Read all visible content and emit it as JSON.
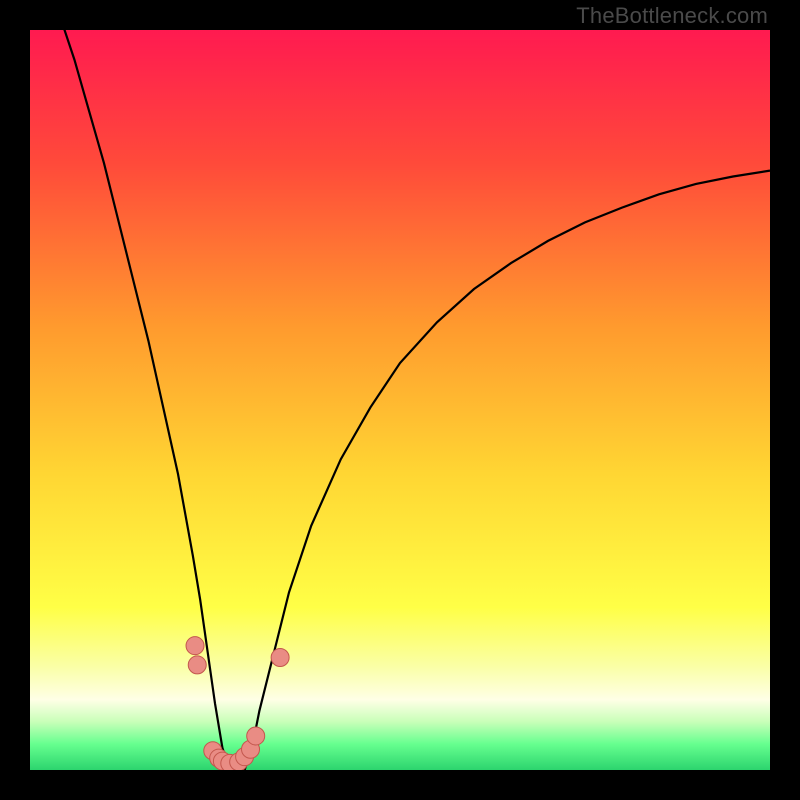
{
  "watermark": "TheBottleneck.com",
  "colors": {
    "black": "#000000",
    "curve_stroke": "#000000",
    "marker_fill": "#e98c84",
    "marker_stroke": "#c3574d"
  },
  "gradient_stops": [
    {
      "offset": 0.0,
      "color": "#ff1a50"
    },
    {
      "offset": 0.18,
      "color": "#ff4a3a"
    },
    {
      "offset": 0.4,
      "color": "#ff9a2e"
    },
    {
      "offset": 0.6,
      "color": "#ffd633"
    },
    {
      "offset": 0.78,
      "color": "#ffff46"
    },
    {
      "offset": 0.86,
      "color": "#faffa6"
    },
    {
      "offset": 0.905,
      "color": "#ffffe6"
    },
    {
      "offset": 0.935,
      "color": "#c8ffb8"
    },
    {
      "offset": 0.965,
      "color": "#66ff8f"
    },
    {
      "offset": 1.0,
      "color": "#2cd46e"
    }
  ],
  "chart_data": {
    "type": "line",
    "title": "",
    "xlabel": "",
    "ylabel": "",
    "xlim": [
      0,
      100
    ],
    "ylim": [
      0,
      100
    ],
    "series": [
      {
        "name": "curve",
        "x": [
          4,
          6,
          8,
          10,
          12,
          14,
          16,
          18,
          20,
          22,
          23,
          24,
          25,
          26,
          27,
          28,
          29,
          30,
          31,
          33,
          35,
          38,
          42,
          46,
          50,
          55,
          60,
          65,
          70,
          75,
          80,
          85,
          90,
          95,
          100
        ],
        "y": [
          102,
          96,
          89,
          82,
          74,
          66,
          58,
          49,
          40,
          29,
          23,
          16,
          9,
          3,
          0,
          0,
          0,
          3,
          8,
          16,
          24,
          33,
          42,
          49,
          55,
          60.5,
          65,
          68.5,
          71.5,
          74,
          76,
          77.8,
          79.2,
          80.2,
          81
        ]
      }
    ],
    "markers": [
      {
        "x": 22.3,
        "y": 16.8
      },
      {
        "x": 22.6,
        "y": 14.2
      },
      {
        "x": 24.7,
        "y": 2.6
      },
      {
        "x": 25.5,
        "y": 1.6
      },
      {
        "x": 26.0,
        "y": 1.2
      },
      {
        "x": 27.0,
        "y": 0.9
      },
      {
        "x": 28.2,
        "y": 1.1
      },
      {
        "x": 29.0,
        "y": 1.8
      },
      {
        "x": 29.8,
        "y": 2.8
      },
      {
        "x": 30.5,
        "y": 4.6
      },
      {
        "x": 33.8,
        "y": 15.2
      }
    ]
  }
}
